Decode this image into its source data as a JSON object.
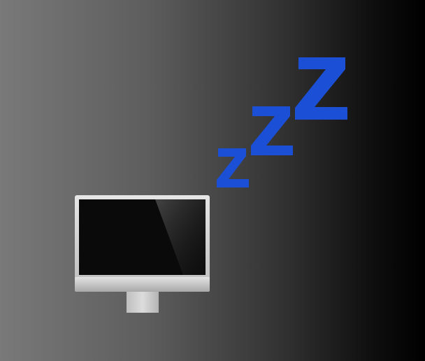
{
  "scene": {
    "description_icon": "computer-sleep-icon",
    "sleep_letters": [
      "z",
      "Z",
      "Z"
    ],
    "colors": {
      "sleep_blue": "#1a4fd6",
      "screen": "#0a0a0a",
      "bezel": "#d8d8d8",
      "stand": "#c9c9c9"
    }
  }
}
